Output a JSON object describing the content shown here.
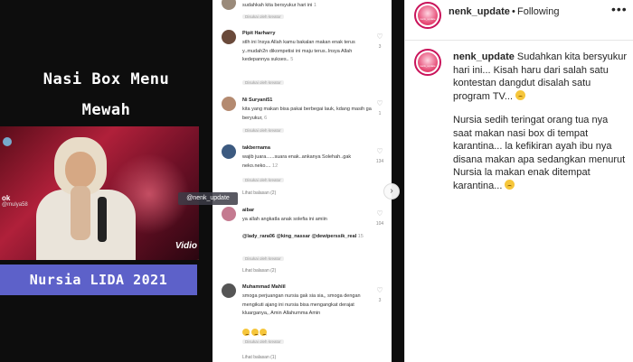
{
  "media": {
    "title_line1": "Nasi Box Menu",
    "title_line2": "Mewah",
    "video_tag": "ok",
    "video_tag2": "@mulya58",
    "video_logo": "Vidio",
    "banner": "Nursia LIDA 2021"
  },
  "handle_tag": "@nenk_update",
  "comments": [
    {
      "name": "",
      "text": "sudahkah kita bersyukur hari ini",
      "count": "1",
      "liked_by": "Disukai oleh kreator"
    },
    {
      "name": "Pipit Harharry",
      "text": "stlh ini Insya Allah kamu bakalan makan enak terus y..mudah2n dikompetisi ini maju terus..Insya Allah kedepannya sukses..",
      "count": "5",
      "liked_by": "Disukai oleh kreator",
      "likes": "3"
    },
    {
      "name": "Ni Suryani51",
      "text": "kita yang makan bisa pakai berbegai lauk, kdang masih ga beryukur,",
      "count": "6",
      "liked_by": "Disukai oleh kreator",
      "likes": "1"
    },
    {
      "name": "takbernama",
      "text": "wajib juara......suara enak..ankanya Solehah..gak neko.neko....",
      "count": "12",
      "liked_by": "Disukai oleh kreator",
      "likes": "134",
      "replies": "Lihat balasan (2)"
    },
    {
      "name": "aibar",
      "text": "ya allah angkatla anak solefia ini amiin",
      "mentions": "@lady_rara06 @king_nassar @dewiperssik_real",
      "count": "15",
      "liked_by": "Disukai oleh kreator",
      "likes": "104",
      "replies": "Lihat balasan (2)"
    },
    {
      "name": "Muhammad Mahlil",
      "text": "smoga perjuangan nursia gak sia sia,, smoga dengan mengikuti ajang ini nursia bisa mengangkat derajat kluarganya,, Amin Allahumma Amin",
      "liked_by": "Disukai oleh kreator",
      "likes": "3",
      "replies": "Lihat balasan (1)"
    }
  ],
  "post": {
    "username": "nenk_update",
    "follow_status": "Following",
    "more": "•••",
    "avatar_text": "nenk_update",
    "caption_user": "nenk_update",
    "caption_p1": "Sudahkan kita bersyukur hari ini... Kisah haru dari salah satu kontestan dangdut disalah satu program TV...",
    "caption_p2": "Nursia sedih teringat orang tua nya saat makan nasi box di tempat karantina... la kefikiran ayah ibu nya disana makan apa sedangkan menurut Nursia la makan enak ditempat karantina..."
  },
  "colors": {
    "banner": "#5d61c9",
    "avatar_ring": "#c9135a",
    "dark": "#0d0d0d"
  }
}
